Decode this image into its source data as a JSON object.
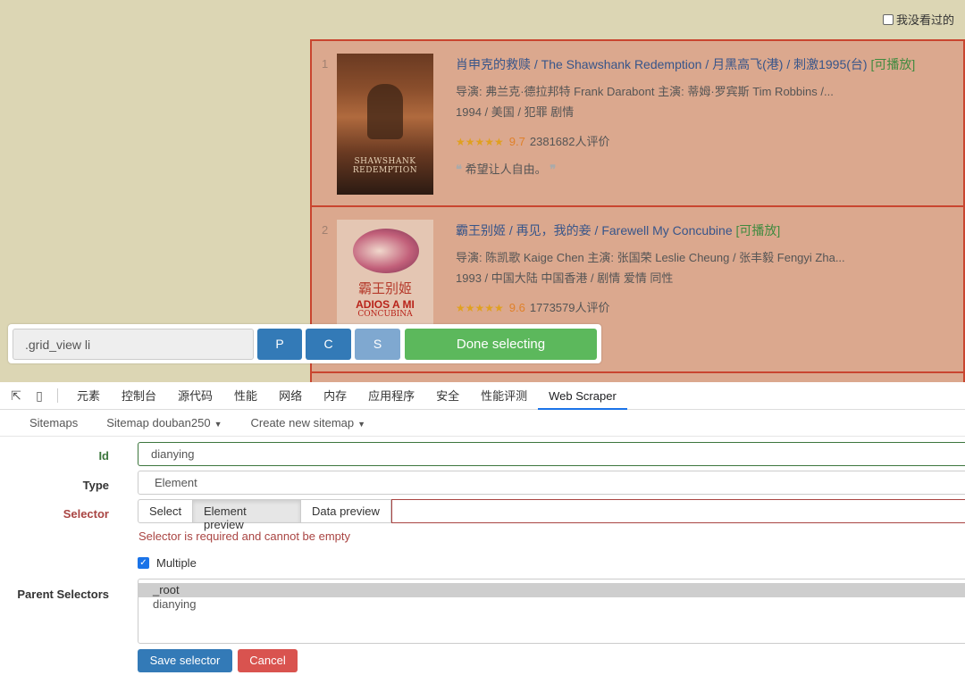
{
  "page": {
    "unwatched_label": "我没看过的",
    "movies": [
      {
        "rank": "1",
        "poster_text": "SHAWSHANK REDEMPTION",
        "title": "肖申克的救赎",
        "title_rest": " / The Shawshank Redemption  / 月黑高飞(港) / 刺激1995(台) ",
        "playable": "[可播放]",
        "credits": "导演: 弗兰克·德拉邦特 Frank Darabont   主演: 蒂姆·罗宾斯 Tim Robbins /...",
        "meta": "1994 / 美国 / 犯罪 剧情",
        "stars": "★★★★★",
        "score": "9.7",
        "votes": "2381682人评价",
        "quote": "希望让人自由。"
      },
      {
        "rank": "2",
        "poster_cn": "霸王别姬",
        "poster_en1": "ADIOS A MI",
        "poster_en2": "CONCUBINA",
        "title": "霸王别姬",
        "title_rest": " / 再见，我的妾 / Farewell My Concubine ",
        "playable": "[可播放]",
        "credits": "导演: 陈凯歌 Kaige Chen   主演: 张国荣 Leslie Cheung / 张丰毅 Fengyi Zha...",
        "meta": "1993 / 中国大陆 中国香港 / 剧情 爱情 同性",
        "stars": "★★★★★",
        "score": "9.6",
        "votes": "1773579人评价"
      }
    ]
  },
  "toolbar": {
    "selector_value": ".grid_view li",
    "p_label": "P",
    "c_label": "C",
    "s_label": "S",
    "done_label": "Done selecting"
  },
  "devtools": {
    "tabs": [
      "元素",
      "控制台",
      "源代码",
      "性能",
      "网络",
      "内存",
      "应用程序",
      "安全",
      "性能评测",
      "Web Scraper"
    ],
    "active_tab": "Web Scraper"
  },
  "nav": {
    "sitemaps": "Sitemaps",
    "sitemap_current": "Sitemap douban250",
    "create_new": "Create new sitemap"
  },
  "form": {
    "id_label": "Id",
    "id_value": "dianying",
    "type_label": "Type",
    "type_value": "Element",
    "selector_label": "Selector",
    "select_btn": "Select",
    "element_preview_btn": "Element preview",
    "data_preview_btn": "Data preview",
    "selector_value": "",
    "selector_error": "Selector is required and cannot be empty",
    "multiple_label": "Multiple",
    "multiple_checked": true,
    "parent_label": "Parent Selectors",
    "parent_options": [
      "_root",
      "dianying"
    ],
    "parent_selected": "_root",
    "save_label": "Save selector",
    "cancel_label": "Cancel"
  },
  "colors": {
    "highlight_fill": "#dba88e",
    "highlight_border": "#c9452f",
    "primary": "#337ab7",
    "success": "#5cb85c",
    "danger": "#d9534f",
    "error_text": "#a94442"
  }
}
